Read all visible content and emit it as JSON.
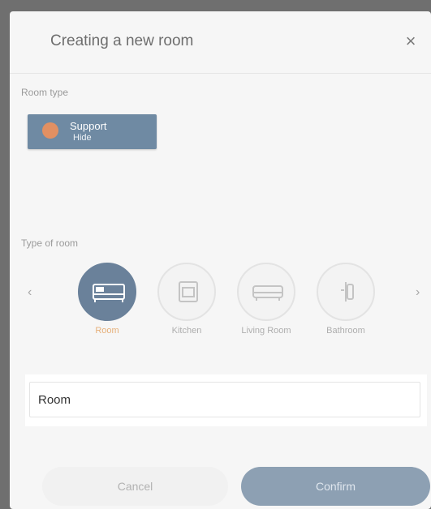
{
  "modal": {
    "title": "Creating a new room",
    "close_icon": "close-icon"
  },
  "room_type_section": {
    "label": "Room type",
    "selected_chip": {
      "name": "Support",
      "subtitle": "Hide",
      "icon": "chip-icon"
    }
  },
  "type_of_room": {
    "label": "Type of room",
    "prev_icon": "chevron-left-icon",
    "next_icon": "chevron-right-icon",
    "items": [
      {
        "label": "Room",
        "icon": "bed-icon",
        "selected": true
      },
      {
        "label": "Kitchen",
        "icon": "oven-icon",
        "selected": false
      },
      {
        "label": "Living Room",
        "icon": "sofa-icon",
        "selected": false
      },
      {
        "label": "Bathroom",
        "icon": "shower-icon",
        "selected": false
      }
    ]
  },
  "name_field": {
    "value": "Room"
  },
  "footer": {
    "cancel_label": "Cancel",
    "confirm_label": "Confirm"
  },
  "colors": {
    "accent": "#6a819a",
    "selected_label": "#e6b07a",
    "chip": "#6f8aa3"
  }
}
